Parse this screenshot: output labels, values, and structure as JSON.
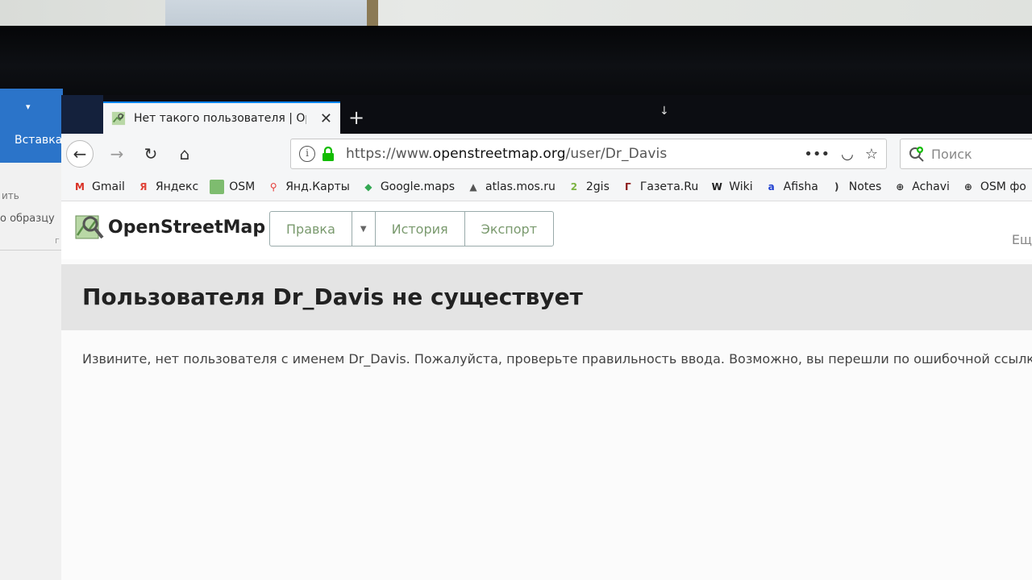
{
  "background_app": {
    "quick_access": "▾",
    "ribbon_label": "Вставка",
    "text_1": "ить",
    "text_2": "о образцу",
    "text_3": "г"
  },
  "browser": {
    "tab": {
      "title": "Нет такого пользователя | Op",
      "close": "✕"
    },
    "new_tab": "+",
    "download_arrow": "↓",
    "nav": {
      "back": "←",
      "forward": "→",
      "reload": "↻",
      "home": "⌂"
    },
    "url": {
      "prefix": "https://www.",
      "host": "openstreetmap.org",
      "path": "/user/Dr_Davis"
    },
    "url_tools": {
      "more": "•••",
      "pocket": "◡",
      "star": "☆"
    },
    "search_placeholder": "Поиск",
    "bookmarks": [
      {
        "label": "Gmail",
        "icon": "gmail-icon",
        "glyph": "M",
        "color": "#d93025"
      },
      {
        "label": "Яндекс",
        "icon": "yandex-icon",
        "glyph": "Я",
        "color": "#e0443a"
      },
      {
        "label": "OSM",
        "icon": "osm-icon",
        "glyph": "",
        "color": "#7ebc6f"
      },
      {
        "label": "Янд.Карты",
        "icon": "map-pin-icon",
        "glyph": "⚲",
        "color": "#e53935"
      },
      {
        "label": "Google.maps",
        "icon": "google-maps-icon",
        "glyph": "◆",
        "color": "#34a853"
      },
      {
        "label": "atlas.mos.ru",
        "icon": "atlas-icon",
        "glyph": "▲",
        "color": "#555555"
      },
      {
        "label": "2gis",
        "icon": "2gis-icon",
        "glyph": "2",
        "color": "#7cb342"
      },
      {
        "label": "Газета.Ru",
        "icon": "gazeta-icon",
        "glyph": "Г",
        "color": "#8b1a1a"
      },
      {
        "label": "Wiki",
        "icon": "wikipedia-icon",
        "glyph": "W",
        "color": "#222222"
      },
      {
        "label": "Afisha",
        "icon": "afisha-icon",
        "glyph": "a",
        "color": "#1e3fd1"
      },
      {
        "label": "Notes",
        "icon": "rss-icon",
        "glyph": ")",
        "color": "#333333"
      },
      {
        "label": "Achavi",
        "icon": "globe-icon",
        "glyph": "⊕",
        "color": "#333333"
      },
      {
        "label": "OSM фо",
        "icon": "globe-icon",
        "glyph": "⊕",
        "color": "#333333"
      }
    ]
  },
  "osm": {
    "brand": "OpenStreetMap",
    "buttons": {
      "edit": "Правка",
      "caret": "▼",
      "history": "История",
      "export": "Экспорт"
    },
    "more": "Ещ",
    "heading": "Пользователя Dr_Davis не существует",
    "message": "Извините, нет пользователя с именем Dr_Davis. Пожалуйста, проверьте правильность ввода. Возможно, вы перешли по ошибочной ссылке",
    "accent_color": "#7ebc6f"
  }
}
